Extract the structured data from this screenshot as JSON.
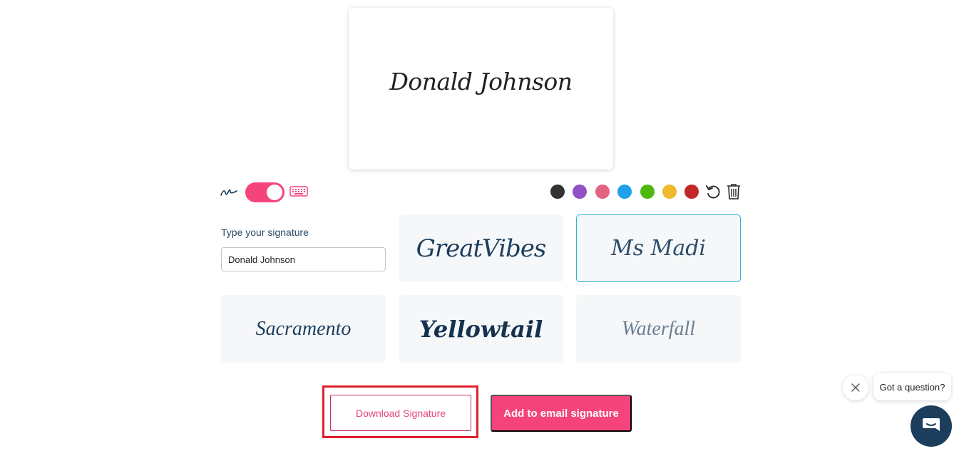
{
  "preview": {
    "signature_text": "Donald Johnson"
  },
  "mode_toggle": {
    "state": "typed"
  },
  "colors": [
    "#333333",
    "#9152c6",
    "#e36383",
    "#1ea1e8",
    "#4fb80e",
    "#f0b92d",
    "#c22828"
  ],
  "type_section": {
    "label": "Type your signature",
    "value": "Donald Johnson"
  },
  "fonts": [
    {
      "label": "GreatVibes",
      "selected": false
    },
    {
      "label": "Ms Madi",
      "selected": true
    },
    {
      "label": "Sacramento",
      "selected": false
    },
    {
      "label": "Yellowtail",
      "selected": false
    },
    {
      "label": "Waterfall",
      "selected": false
    }
  ],
  "actions": {
    "download_label": "Download Signature",
    "email_label": "Add to email signature"
  },
  "chat": {
    "prompt": "Got a question?"
  }
}
